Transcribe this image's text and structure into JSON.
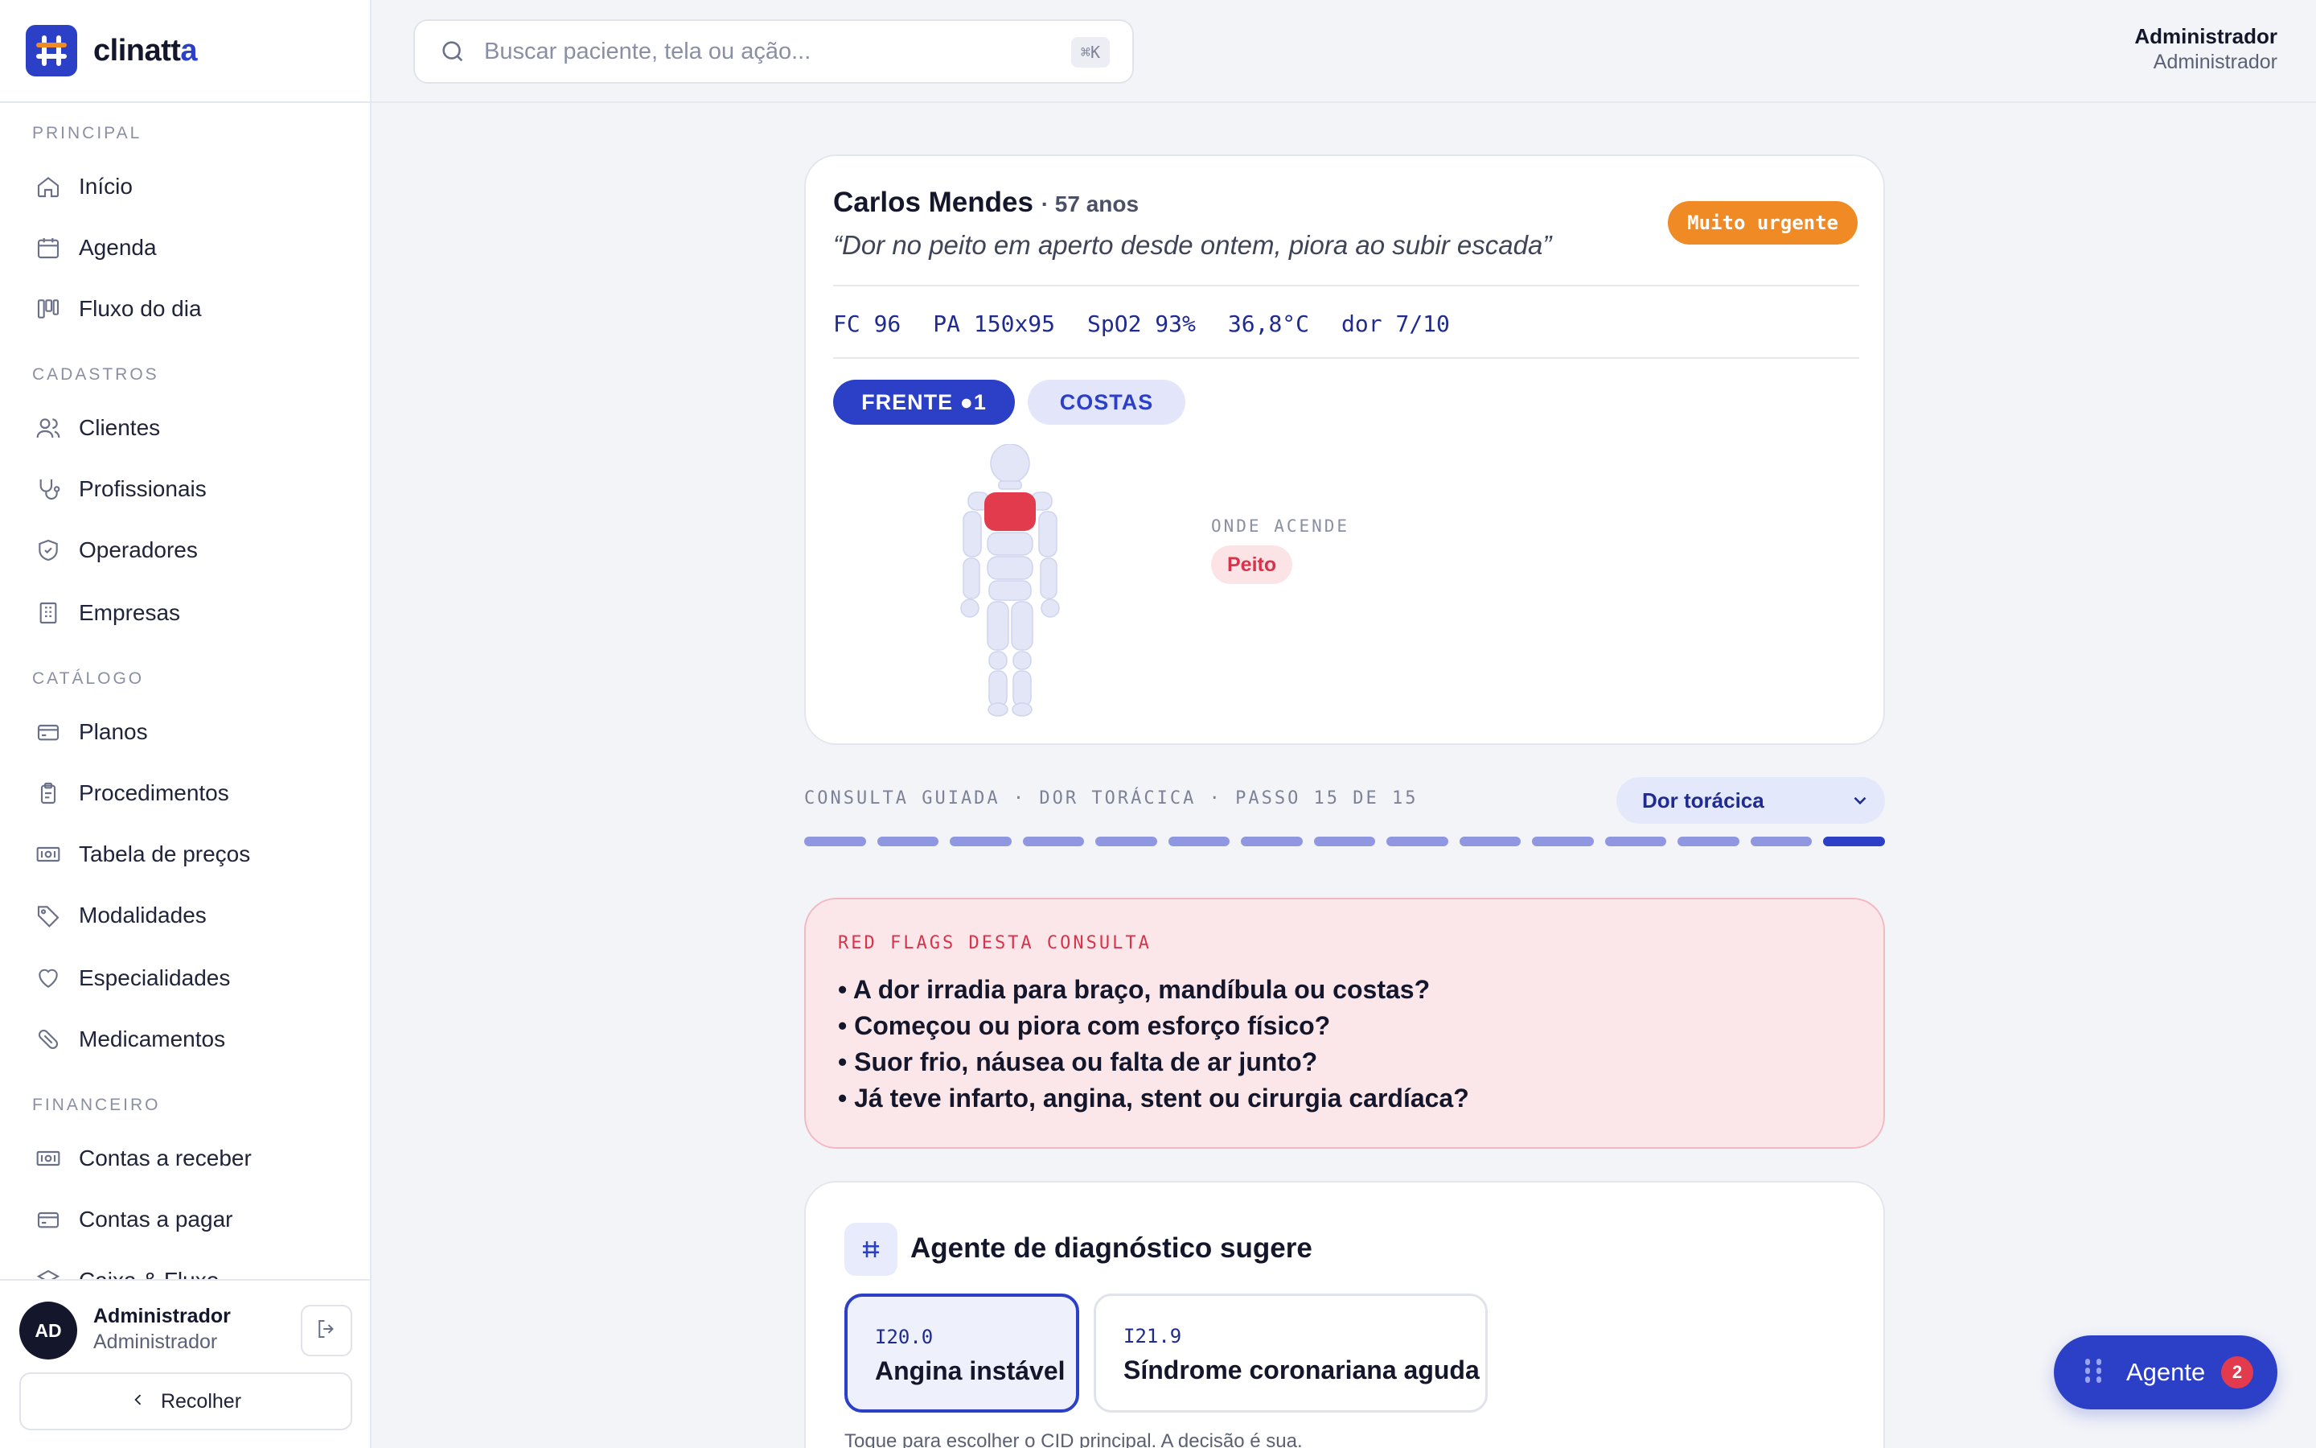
{
  "brand": {
    "name_main": "clinatt",
    "name_accent": "a"
  },
  "search": {
    "placeholder": "Buscar paciente, tela ou ação...",
    "shortcut": "⌘K"
  },
  "header_user": {
    "name": "Administrador",
    "role": "Administrador"
  },
  "sidebar": {
    "sections": [
      {
        "label": "PRINCIPAL",
        "items": [
          {
            "label": "Início",
            "icon": "home-icon"
          },
          {
            "label": "Agenda",
            "icon": "calendar-icon"
          },
          {
            "label": "Fluxo do dia",
            "icon": "kanban-icon"
          }
        ]
      },
      {
        "label": "CADASTROS",
        "items": [
          {
            "label": "Clientes",
            "icon": "users-icon"
          },
          {
            "label": "Profissionais",
            "icon": "stethoscope-icon"
          },
          {
            "label": "Operadores",
            "icon": "shield-icon"
          },
          {
            "label": "Empresas",
            "icon": "building-icon"
          }
        ]
      },
      {
        "label": "CATÁLOGO",
        "items": [
          {
            "label": "Planos",
            "icon": "card-icon"
          },
          {
            "label": "Procedimentos",
            "icon": "clipboard-icon"
          },
          {
            "label": "Tabela de preços",
            "icon": "banknote-icon"
          },
          {
            "label": "Modalidades",
            "icon": "tag-icon"
          },
          {
            "label": "Especialidades",
            "icon": "heart-icon"
          },
          {
            "label": "Medicamentos",
            "icon": "pill-icon"
          }
        ]
      },
      {
        "label": "FINANCEIRO",
        "items": [
          {
            "label": "Contas a receber",
            "icon": "banknote-icon"
          },
          {
            "label": "Contas a pagar",
            "icon": "card-icon"
          },
          {
            "label": "Caixa & Fluxo",
            "icon": "layers-icon"
          }
        ]
      }
    ],
    "user": {
      "initials": "AD",
      "name": "Administrador",
      "role": "Administrador"
    },
    "collapse_label": "Recolher"
  },
  "patient": {
    "name": "Carlos Mendes",
    "age": "· 57 anos",
    "complaint": "“Dor no peito em aperto desde ontem, piora ao subir escada”",
    "urgency": "Muito urgente",
    "vitals": [
      "FC 96",
      "PA 150x95",
      "SpO2 93%",
      "36,8°C",
      "dor 7/10"
    ],
    "tabs": {
      "front": "FRENTE ●1",
      "back": "COSTAS"
    },
    "where_label": "ONDE ACENDE",
    "locations": [
      "Peito"
    ]
  },
  "consult": {
    "step_label": "CONSULTA GUIADA · DOR TORÁCICA · PASSO 15 DE 15",
    "protocol_selected": "Dor torácica",
    "current_step": 15,
    "total_steps": 15
  },
  "red_flags": {
    "title": "RED FLAGS DESTA CONSULTA",
    "items": [
      "• A dor irradia para braço, mandíbula ou costas?",
      "• Começou ou piora com esforço físico?",
      "• Suor frio, náusea ou falta de ar junto?",
      "• Já teve infarto, angina, stent ou cirurgia cardíaca?"
    ]
  },
  "agent": {
    "title": "Agente de diagnóstico sugere",
    "suggestions": [
      {
        "code": "I20.0",
        "name": "Angina instável",
        "selected": true
      },
      {
        "code": "I21.9",
        "name": "Síndrome coronariana aguda",
        "selected": false
      }
    ],
    "hint": "Toque para escolher o CID principal. A decisão é sua."
  },
  "fab": {
    "label": "Agente",
    "badge": "2"
  },
  "colors": {
    "primary": "#2b3fc7",
    "urgent": "#f08a24",
    "danger": "#d8334a",
    "highlight": "#e23b4e"
  }
}
